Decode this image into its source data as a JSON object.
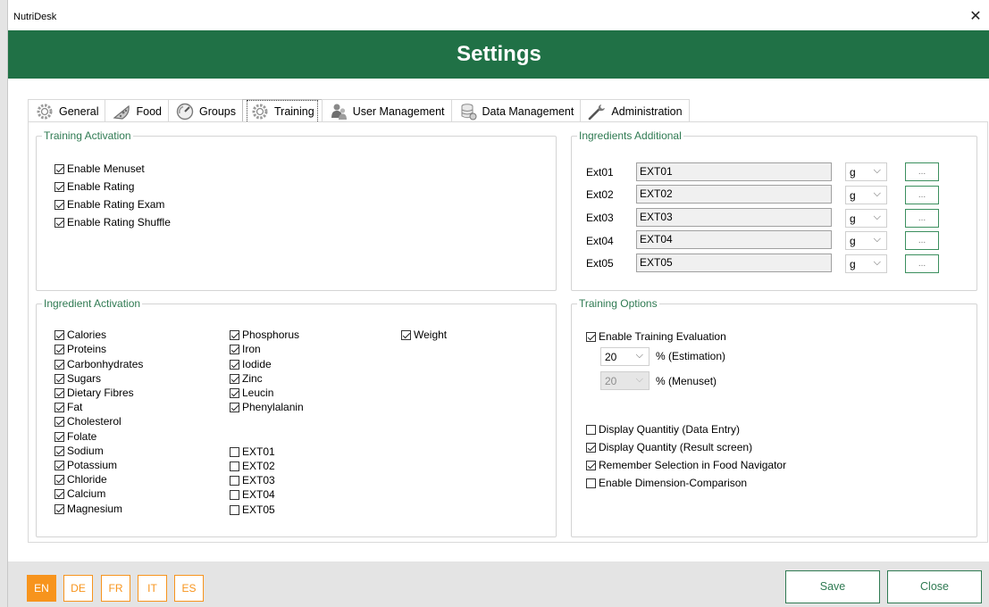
{
  "window": {
    "app_title": "NutriDesk",
    "close_glyph": "✕"
  },
  "banner": {
    "title": "Settings",
    "color": "#207146"
  },
  "tabs": [
    {
      "label": "General",
      "icon": "gear-icon"
    },
    {
      "label": "Food",
      "icon": "pizza-icon"
    },
    {
      "label": "Groups",
      "icon": "gauge-icon"
    },
    {
      "label": "Training",
      "icon": "gear-icon",
      "active": true
    },
    {
      "label": "User Management",
      "icon": "users-icon"
    },
    {
      "label": "Data Management",
      "icon": "database-icon"
    },
    {
      "label": "Administration",
      "icon": "wrench-icon"
    }
  ],
  "training_activation": {
    "legend": "Training Activation",
    "items": [
      {
        "label": "Enable Menuset",
        "checked": true
      },
      {
        "label": "Enable Rating",
        "checked": true
      },
      {
        "label": "Enable Rating Exam",
        "checked": true
      },
      {
        "label": "Enable Rating Shuffle",
        "checked": true
      }
    ]
  },
  "ingredients_additional": {
    "legend": "Ingredients Additional",
    "rows": [
      {
        "label": "Ext01",
        "value": "EXT01",
        "unit": "g",
        "button": "..."
      },
      {
        "label": "Ext02",
        "value": "EXT02",
        "unit": "g",
        "button": "..."
      },
      {
        "label": "Ext03",
        "value": "EXT03",
        "unit": "g",
        "button": "..."
      },
      {
        "label": "Ext04",
        "value": "EXT04",
        "unit": "g",
        "button": "..."
      },
      {
        "label": "Ext05",
        "value": "EXT05",
        "unit": "g",
        "button": "..."
      }
    ]
  },
  "ingredient_activation": {
    "legend": "Ingredient Activation",
    "col1": [
      {
        "label": "Calories",
        "checked": true
      },
      {
        "label": "Proteins",
        "checked": true
      },
      {
        "label": "Carbonhydrates",
        "checked": true
      },
      {
        "label": "Sugars",
        "checked": true
      },
      {
        "label": "Dietary Fibres",
        "checked": true
      },
      {
        "label": "Fat",
        "checked": true
      },
      {
        "label": "Cholesterol",
        "checked": true
      },
      {
        "label": "Folate",
        "checked": true
      },
      {
        "label": "Sodium",
        "checked": true
      },
      {
        "label": "Potassium",
        "checked": true
      },
      {
        "label": "Chloride",
        "checked": true
      },
      {
        "label": "Calcium",
        "checked": true
      },
      {
        "label": "Magnesium",
        "checked": true
      }
    ],
    "col2_top": [
      {
        "label": "Phosphorus",
        "checked": true
      },
      {
        "label": "Iron",
        "checked": true
      },
      {
        "label": "Iodide",
        "checked": true
      },
      {
        "label": "Zinc",
        "checked": true
      },
      {
        "label": "Leucin",
        "checked": true
      },
      {
        "label": "Phenylalanin",
        "checked": true
      }
    ],
    "col2_bottom": [
      {
        "label": "EXT01",
        "checked": false
      },
      {
        "label": "EXT02",
        "checked": false
      },
      {
        "label": "EXT03",
        "checked": false
      },
      {
        "label": "EXT04",
        "checked": false
      },
      {
        "label": "EXT05",
        "checked": false
      }
    ],
    "col3": [
      {
        "label": "Weight",
        "checked": true
      }
    ]
  },
  "training_options": {
    "legend": "Training Options",
    "enable_evaluation": {
      "label": "Enable Training Evaluation",
      "checked": true
    },
    "estimation": {
      "value": "20",
      "label": "% (Estimation)"
    },
    "menuset": {
      "value": "20",
      "label": "% (Menuset)",
      "disabled": true
    },
    "options": [
      {
        "label": "Display Quantitiy (Data Entry)",
        "checked": false
      },
      {
        "label": "Display Quantity (Result screen)",
        "checked": true
      },
      {
        "label": "Remember Selection in Food Navigator",
        "checked": true
      },
      {
        "label": "Enable Dimension-Comparison",
        "checked": false
      }
    ]
  },
  "bottom": {
    "languages": [
      {
        "code": "EN",
        "active": true
      },
      {
        "code": "DE",
        "active": false
      },
      {
        "code": "FR",
        "active": false
      },
      {
        "code": "IT",
        "active": false
      },
      {
        "code": "ES",
        "active": false
      }
    ],
    "save_label": "Save",
    "close_label": "Close",
    "accent": "#f7941d",
    "button_color": "#2f7a52"
  }
}
